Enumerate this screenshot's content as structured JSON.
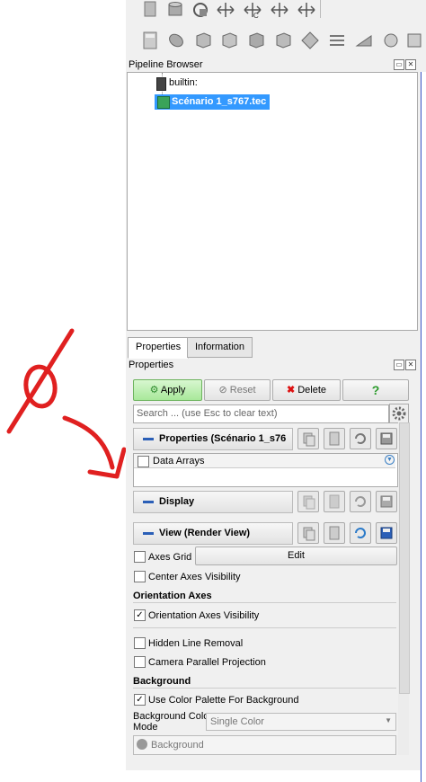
{
  "colors": {
    "accent": "#2b5fb7",
    "selection": "#3399ff",
    "annotation": "#e02020",
    "apply_green": "#a8e89a"
  },
  "toolbar_row1": [
    "box-icon",
    "cylinder-icon",
    "refresh-icon",
    "scale-x-icon",
    "scale-c-icon",
    "scale-y-icon",
    "scale-z-icon"
  ],
  "toolbar_row2": [
    "calculator-icon",
    "contour-icon",
    "clip-icon",
    "slice-icon",
    "threshold-icon",
    "extract-icon",
    "glyph-icon",
    "stream-icon",
    "warp-icon",
    "group-icon",
    "filter-icon"
  ],
  "pipeline": {
    "title": "Pipeline Browser",
    "items": [
      {
        "label": "builtin:",
        "icon": "server-icon"
      },
      {
        "label": "Scénario 1_s767.tec",
        "icon": "dataset-icon",
        "selected": true
      }
    ]
  },
  "tabs": {
    "properties": "Properties",
    "information": "Information"
  },
  "properties": {
    "title": "Properties",
    "apply": "Apply",
    "reset": "Reset",
    "delete": "Delete",
    "help": "?",
    "search_placeholder": "Search ... (use Esc to clear text)",
    "section_properties": "Properties (Scénario 1_s76",
    "data_arrays": "Data Arrays",
    "section_display": "Display",
    "section_view": "View (Render View)",
    "axes_grid": "Axes Grid",
    "edit": "Edit",
    "center_axes": "Center Axes Visibility",
    "orientation_axes": "Orientation Axes",
    "orientation_axes_visibility": "Orientation Axes Visibility",
    "hidden_line_removal": "Hidden Line Removal",
    "camera_parallel": "Camera Parallel Projection",
    "background": "Background",
    "use_color_palette": "Use Color Palette For Background",
    "bg_color_mode_line1": "Background Color",
    "bg_color_mode_line2": "Mode",
    "bg_color_mode_value": "Single Color",
    "background_button": "Background"
  },
  "checks": {
    "data_arrays": false,
    "axes_grid": false,
    "center_axes": false,
    "orientation_axes_visibility": true,
    "hidden_line_removal": false,
    "camera_parallel": false,
    "use_color_palette": true
  }
}
